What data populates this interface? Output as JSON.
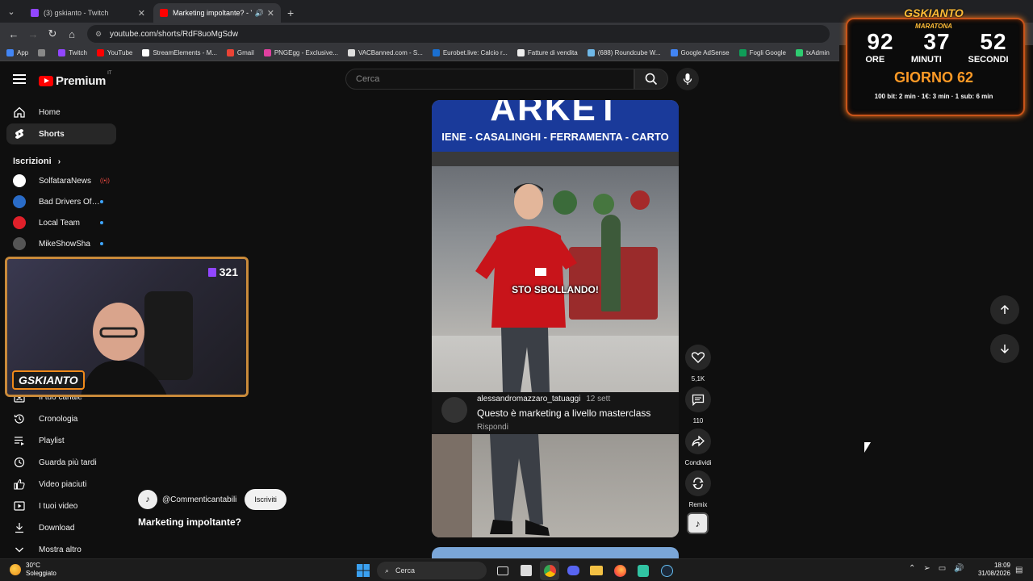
{
  "browser": {
    "tabs": [
      {
        "title": "(3) gskianto - Twitch",
        "color": "#9146ff",
        "active": false
      },
      {
        "title": "Marketing impoltante? - Yo",
        "color": "#ff0000",
        "active": true
      }
    ],
    "url": "youtube.com/shorts/RdF8uoMgSdw",
    "bookmarks": [
      {
        "label": "App",
        "color": "#4285f4"
      },
      {
        "label": "",
        "color": "#888888"
      },
      {
        "label": "Twitch",
        "color": "#9146ff"
      },
      {
        "label": "YouTube",
        "color": "#ff0000"
      },
      {
        "label": "StreamElements - M...",
        "color": "#ffffff"
      },
      {
        "label": "Gmail",
        "color": "#ea4335"
      },
      {
        "label": "PNGEgg - Exclusive...",
        "color": "#e040a0"
      },
      {
        "label": "VACBanned.com - S...",
        "color": "#dddddd"
      },
      {
        "label": "Eurobet.live: Calcio r...",
        "color": "#1a6fd0"
      },
      {
        "label": "Fatture di vendita",
        "color": "#eeeeee"
      },
      {
        "label": "(688) Roundcube W...",
        "color": "#6fb8e8"
      },
      {
        "label": "Google AdSense",
        "color": "#4285f4"
      },
      {
        "label": "Fogli Google",
        "color": "#0f9d58"
      },
      {
        "label": "txAdmin",
        "color": "#2ecc71"
      }
    ]
  },
  "youtube": {
    "logo": "Premium",
    "region": "IT",
    "search_placeholder": "Cerca",
    "nav": [
      {
        "label": "Home",
        "icon": "home-icon",
        "selected": false
      },
      {
        "label": "Shorts",
        "icon": "shorts-icon",
        "selected": true
      }
    ],
    "subscriptions_title": "Iscrizioni",
    "subscriptions": [
      {
        "label": "SolfataraNews",
        "color": "#ffffff",
        "status": "live"
      },
      {
        "label": "Bad Drivers Of It...",
        "color": "#2a6cc8",
        "status": "dot"
      },
      {
        "label": "Local Team",
        "color": "#e0202a",
        "status": "dot"
      },
      {
        "label": "MikeShowSha",
        "color": "#555555",
        "status": "dot"
      }
    ],
    "you_section": [
      {
        "label": "Il tuo canale",
        "icon": "channel-icon"
      },
      {
        "label": "Cronologia",
        "icon": "history-icon"
      },
      {
        "label": "Playlist",
        "icon": "playlist-icon"
      },
      {
        "label": "Guarda più tardi",
        "icon": "watch-later-icon"
      },
      {
        "label": "Video piaciuti",
        "icon": "liked-icon"
      },
      {
        "label": "I tuoi video",
        "icon": "your-videos-icon"
      },
      {
        "label": "Download",
        "icon": "download-icon"
      },
      {
        "label": "Mostra altro",
        "icon": "chevron-down-icon"
      }
    ]
  },
  "short": {
    "sign_big": "ARKET",
    "sign_small": "IENE - CASALINGHI - FERRAMENTA - CARTO",
    "overlay_text": "STO SBOLLANDO!",
    "comment": {
      "author": "alessandromazzaro_tatuaggi",
      "date": "12 sett",
      "text": "Questo è marketing a livello masterclass",
      "reply": "Rispondi"
    },
    "actions": {
      "likes": "5,1K",
      "comments": "110",
      "share": "Condividi",
      "remix": "Remix"
    },
    "channel": "@Commenticantabili",
    "subscribe": "Iscriviti",
    "title": "Marketing impoltante?"
  },
  "stream_overlay": {
    "title": "GSKIANTO",
    "subtitle": "MARATONA",
    "hours": "92",
    "minutes": "37",
    "seconds": "52",
    "hours_label": "ORE",
    "minutes_label": "MINUTI",
    "seconds_label": "SECONDI",
    "day": "GIORNO 62",
    "rates": "100 bit: 2 min · 1€: 3 min · 1 sub: 6 min",
    "viewers": "321",
    "brand": "GSKIANTO"
  },
  "taskbar": {
    "temperature": "30°C",
    "weather": "Soleggiato",
    "search": "Cerca",
    "time": "18:09",
    "date": "31/08/2026"
  }
}
